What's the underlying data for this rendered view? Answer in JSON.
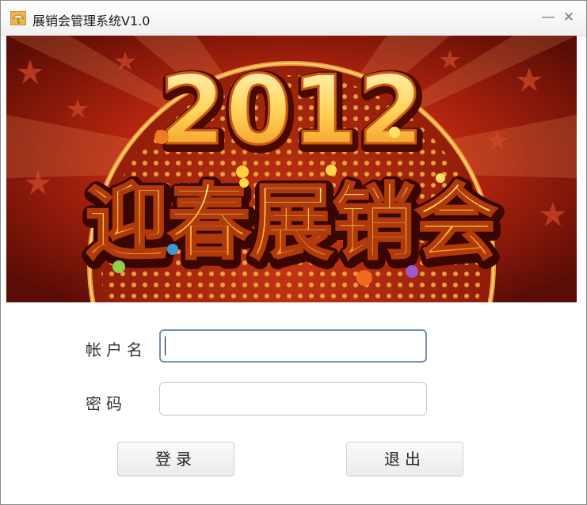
{
  "window": {
    "title": "展销会管理系统V1.0",
    "minimize_label": "—",
    "close_label": "✕"
  },
  "banner": {
    "year": "2012",
    "headline": "迎春展销会"
  },
  "form": {
    "username_label": "帐户名",
    "username_value": "",
    "password_label": "密码",
    "password_value": "",
    "login_label": "登录",
    "exit_label": "退出"
  }
}
